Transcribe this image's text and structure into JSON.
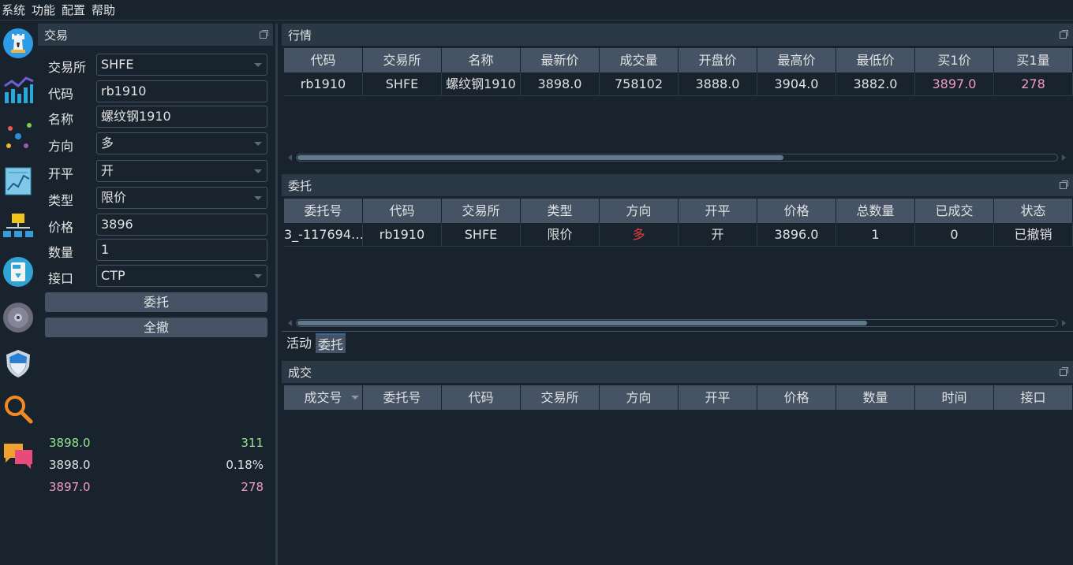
{
  "menu": [
    "系统",
    "功能",
    "配置",
    "帮助"
  ],
  "toolbar_icons": [
    "chess-rook-icon",
    "bar-chart-icon",
    "network-graph-icon",
    "backtest-chart-icon",
    "data-network-icon",
    "csv-download-icon",
    "disc-icon",
    "shield-icon",
    "magnifier-icon",
    "chat-bubble-icon"
  ],
  "trade": {
    "title": "交易",
    "labels": {
      "exchange": "交易所",
      "symbol": "代码",
      "name": "名称",
      "direction": "方向",
      "offset": "开平",
      "type": "类型",
      "price": "价格",
      "volume": "数量",
      "gateway": "接口"
    },
    "values": {
      "exchange": "SHFE",
      "symbol": "rb1910",
      "name": "螺纹钢1910",
      "direction": "多",
      "offset": "开",
      "type": "限价",
      "price": "3896",
      "volume": "1",
      "gateway": "CTP"
    },
    "send_button": "委托",
    "cancel_all_button": "全撤",
    "depth": {
      "ask_price": "3898.0",
      "ask_volume": "311",
      "last_price": "3898.0",
      "change": "0.18%",
      "bid_price": "3897.0",
      "bid_volume": "278"
    }
  },
  "market": {
    "title": "行情",
    "columns": [
      "代码",
      "交易所",
      "名称",
      "最新价",
      "成交量",
      "开盘价",
      "最高价",
      "最低价",
      "买1价",
      "买1量"
    ],
    "rows": [
      [
        "rb1910",
        "SHFE",
        "螺纹钢1910",
        "3898.0",
        "758102",
        "3888.0",
        "3904.0",
        "3882.0",
        "3897.0",
        "278"
      ]
    ],
    "scroll_fraction": 0.64
  },
  "orders": {
    "title": "委托",
    "columns": [
      "委托号",
      "代码",
      "交易所",
      "类型",
      "方向",
      "开平",
      "价格",
      "总数量",
      "已成交",
      "状态"
    ],
    "rows": [
      [
        "3_-117694…",
        "rb1910",
        "SHFE",
        "限价",
        "多",
        "开",
        "3896.0",
        "1",
        "0",
        "已撤销"
      ]
    ],
    "tabs": [
      "活动",
      "委托"
    ],
    "active_tab": 1,
    "scroll_fraction": 0.75
  },
  "trades": {
    "title": "成交",
    "columns": [
      "成交号",
      "委托号",
      "代码",
      "交易所",
      "方向",
      "开平",
      "价格",
      "数量",
      "时间",
      "接口"
    ]
  },
  "colors": {
    "background": "#19232d",
    "header": "#455364",
    "title_bar": "#2b3946",
    "ask": "#93e78e",
    "bid": "#f39bc4",
    "long": "#e23c3c",
    "accent": "#346792"
  }
}
